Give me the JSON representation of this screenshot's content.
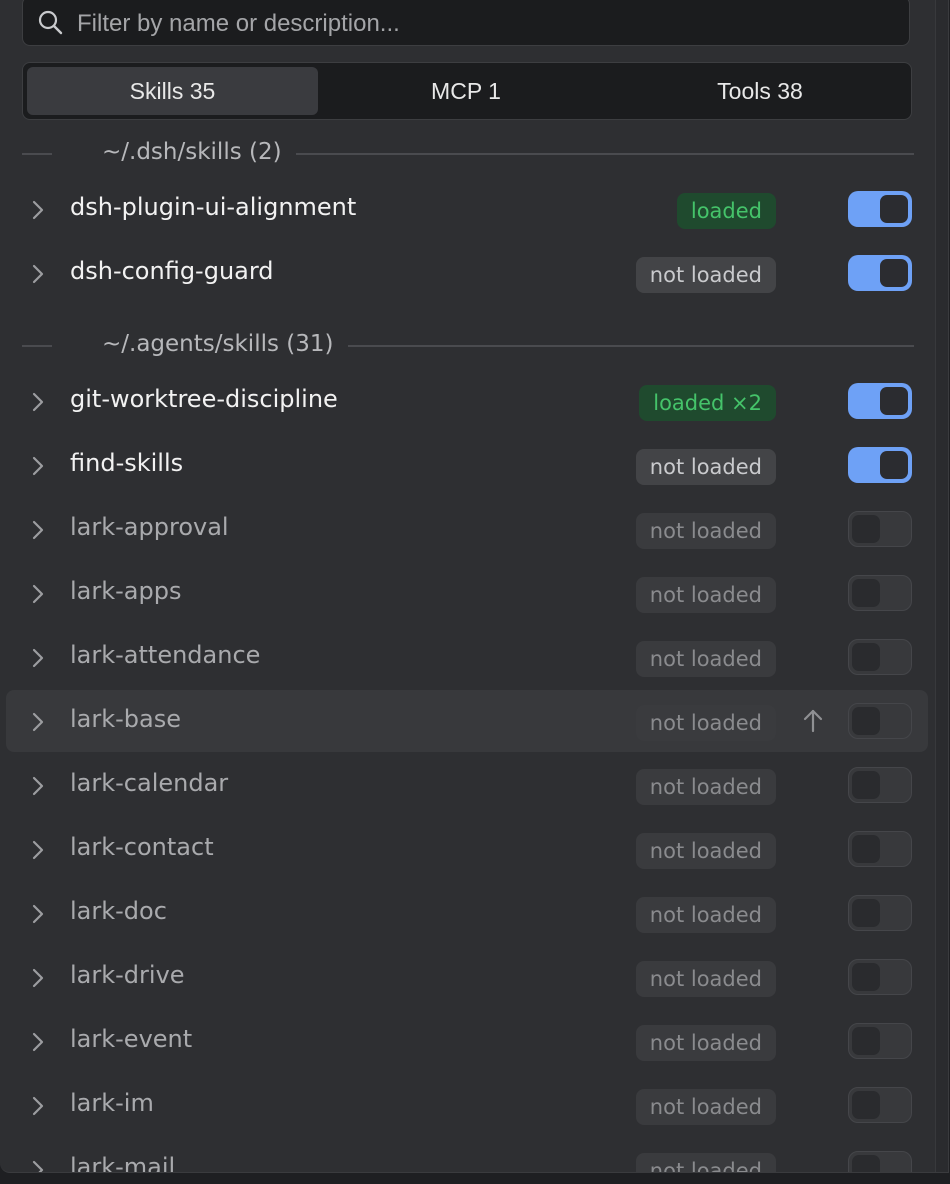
{
  "search": {
    "placeholder": "Filter by name or description..."
  },
  "tabs": [
    {
      "label": "Skills 35",
      "active": true
    },
    {
      "label": "MCP 1",
      "active": false
    },
    {
      "label": "Tools 38",
      "active": false
    }
  ],
  "sections": [
    {
      "label": "~/.dsh/skills (2)",
      "items": [
        {
          "name": "dsh-plugin-ui-alignment",
          "status": "loaded",
          "status_color": "green",
          "enabled": true
        },
        {
          "name": "dsh-config-guard",
          "status": "not loaded",
          "status_color": "gray",
          "enabled": true
        }
      ]
    },
    {
      "label": "~/.agents/skills (31)",
      "items": [
        {
          "name": "git-worktree-discipline",
          "status": "loaded ×2",
          "status_color": "green",
          "enabled": true
        },
        {
          "name": "find-skills",
          "status": "not loaded",
          "status_color": "gray",
          "enabled": true
        },
        {
          "name": "lark-approval",
          "status": "not loaded",
          "status_color": "gray",
          "enabled": false
        },
        {
          "name": "lark-apps",
          "status": "not loaded",
          "status_color": "gray",
          "enabled": false
        },
        {
          "name": "lark-attendance",
          "status": "not loaded",
          "status_color": "gray",
          "enabled": false
        },
        {
          "name": "lark-base",
          "status": "not loaded",
          "status_color": "gray",
          "enabled": false,
          "hovered": true
        },
        {
          "name": "lark-calendar",
          "status": "not loaded",
          "status_color": "gray",
          "enabled": false
        },
        {
          "name": "lark-contact",
          "status": "not loaded",
          "status_color": "gray",
          "enabled": false
        },
        {
          "name": "lark-doc",
          "status": "not loaded",
          "status_color": "gray",
          "enabled": false
        },
        {
          "name": "lark-drive",
          "status": "not loaded",
          "status_color": "gray",
          "enabled": false
        },
        {
          "name": "lark-event",
          "status": "not loaded",
          "status_color": "gray",
          "enabled": false
        },
        {
          "name": "lark-im",
          "status": "not loaded",
          "status_color": "gray",
          "enabled": false
        },
        {
          "name": "lark-mail",
          "status": "not loaded",
          "status_color": "gray",
          "enabled": false
        }
      ]
    }
  ],
  "colors": {
    "accent": "#6ea1f6",
    "loaded_text": "#45c36a",
    "loaded_bg": "#1f4a2e",
    "panel_bg": "#2e2f32"
  },
  "icons": {
    "search": "search-icon",
    "row_expand": "chevron-right-icon",
    "move_up": "arrow-up-icon"
  }
}
